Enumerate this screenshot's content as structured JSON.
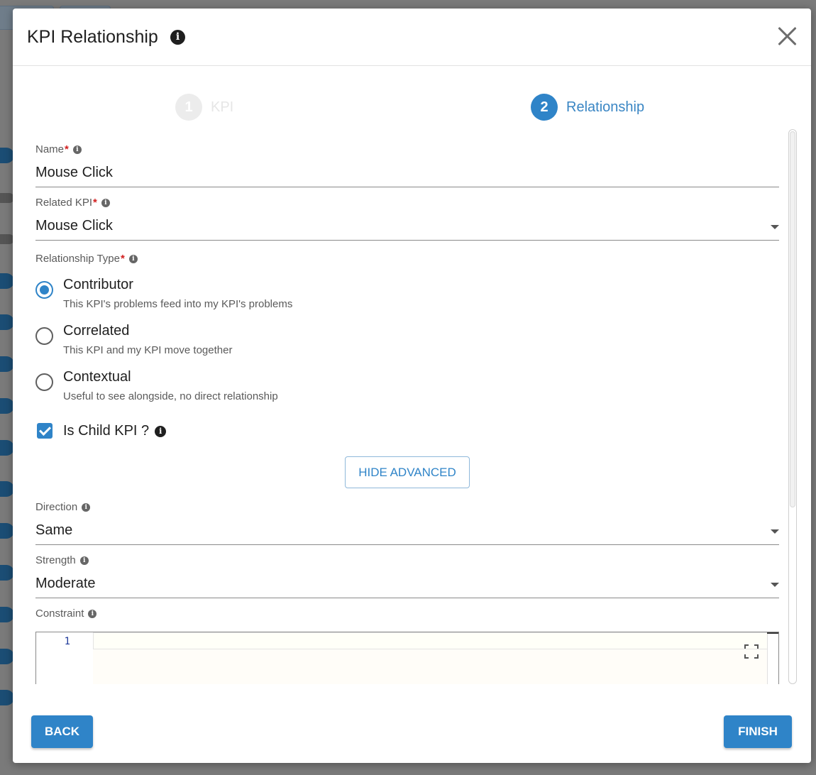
{
  "dialog": {
    "title": "KPI Relationship",
    "info_icon": "info-icon",
    "close_icon": "close-icon"
  },
  "stepper": {
    "steps": [
      {
        "number": "1",
        "label": "KPI",
        "state": "inactive"
      },
      {
        "number": "2",
        "label": "Relationship",
        "state": "active"
      }
    ]
  },
  "form": {
    "name": {
      "label": "Name",
      "required": "*",
      "value": "Mouse Click"
    },
    "related_kpi": {
      "label": "Related KPI",
      "required": "*",
      "value": "Mouse Click"
    },
    "relationship_type": {
      "label": "Relationship Type",
      "required": "*",
      "options": [
        {
          "title": "Contributor",
          "description": "This KPI's problems feed into my KPI's problems",
          "checked": true
        },
        {
          "title": "Correlated",
          "description": "This KPI and my KPI move together",
          "checked": false
        },
        {
          "title": "Contextual",
          "description": "Useful to see alongside, no direct relationship",
          "checked": false
        }
      ]
    },
    "is_child": {
      "label": "Is Child KPI ?",
      "checked": true
    },
    "advanced_button": "HIDE ADVANCED",
    "direction": {
      "label": "Direction",
      "value": "Same"
    },
    "strength": {
      "label": "Strength",
      "value": "Moderate"
    },
    "constraint": {
      "label": "Constraint",
      "line_number": "1",
      "code": ""
    }
  },
  "footer": {
    "back_label": "BACK",
    "finish_label": "FINISH"
  },
  "colors": {
    "accent": "#2f84c8",
    "required": "#d21f1f"
  }
}
